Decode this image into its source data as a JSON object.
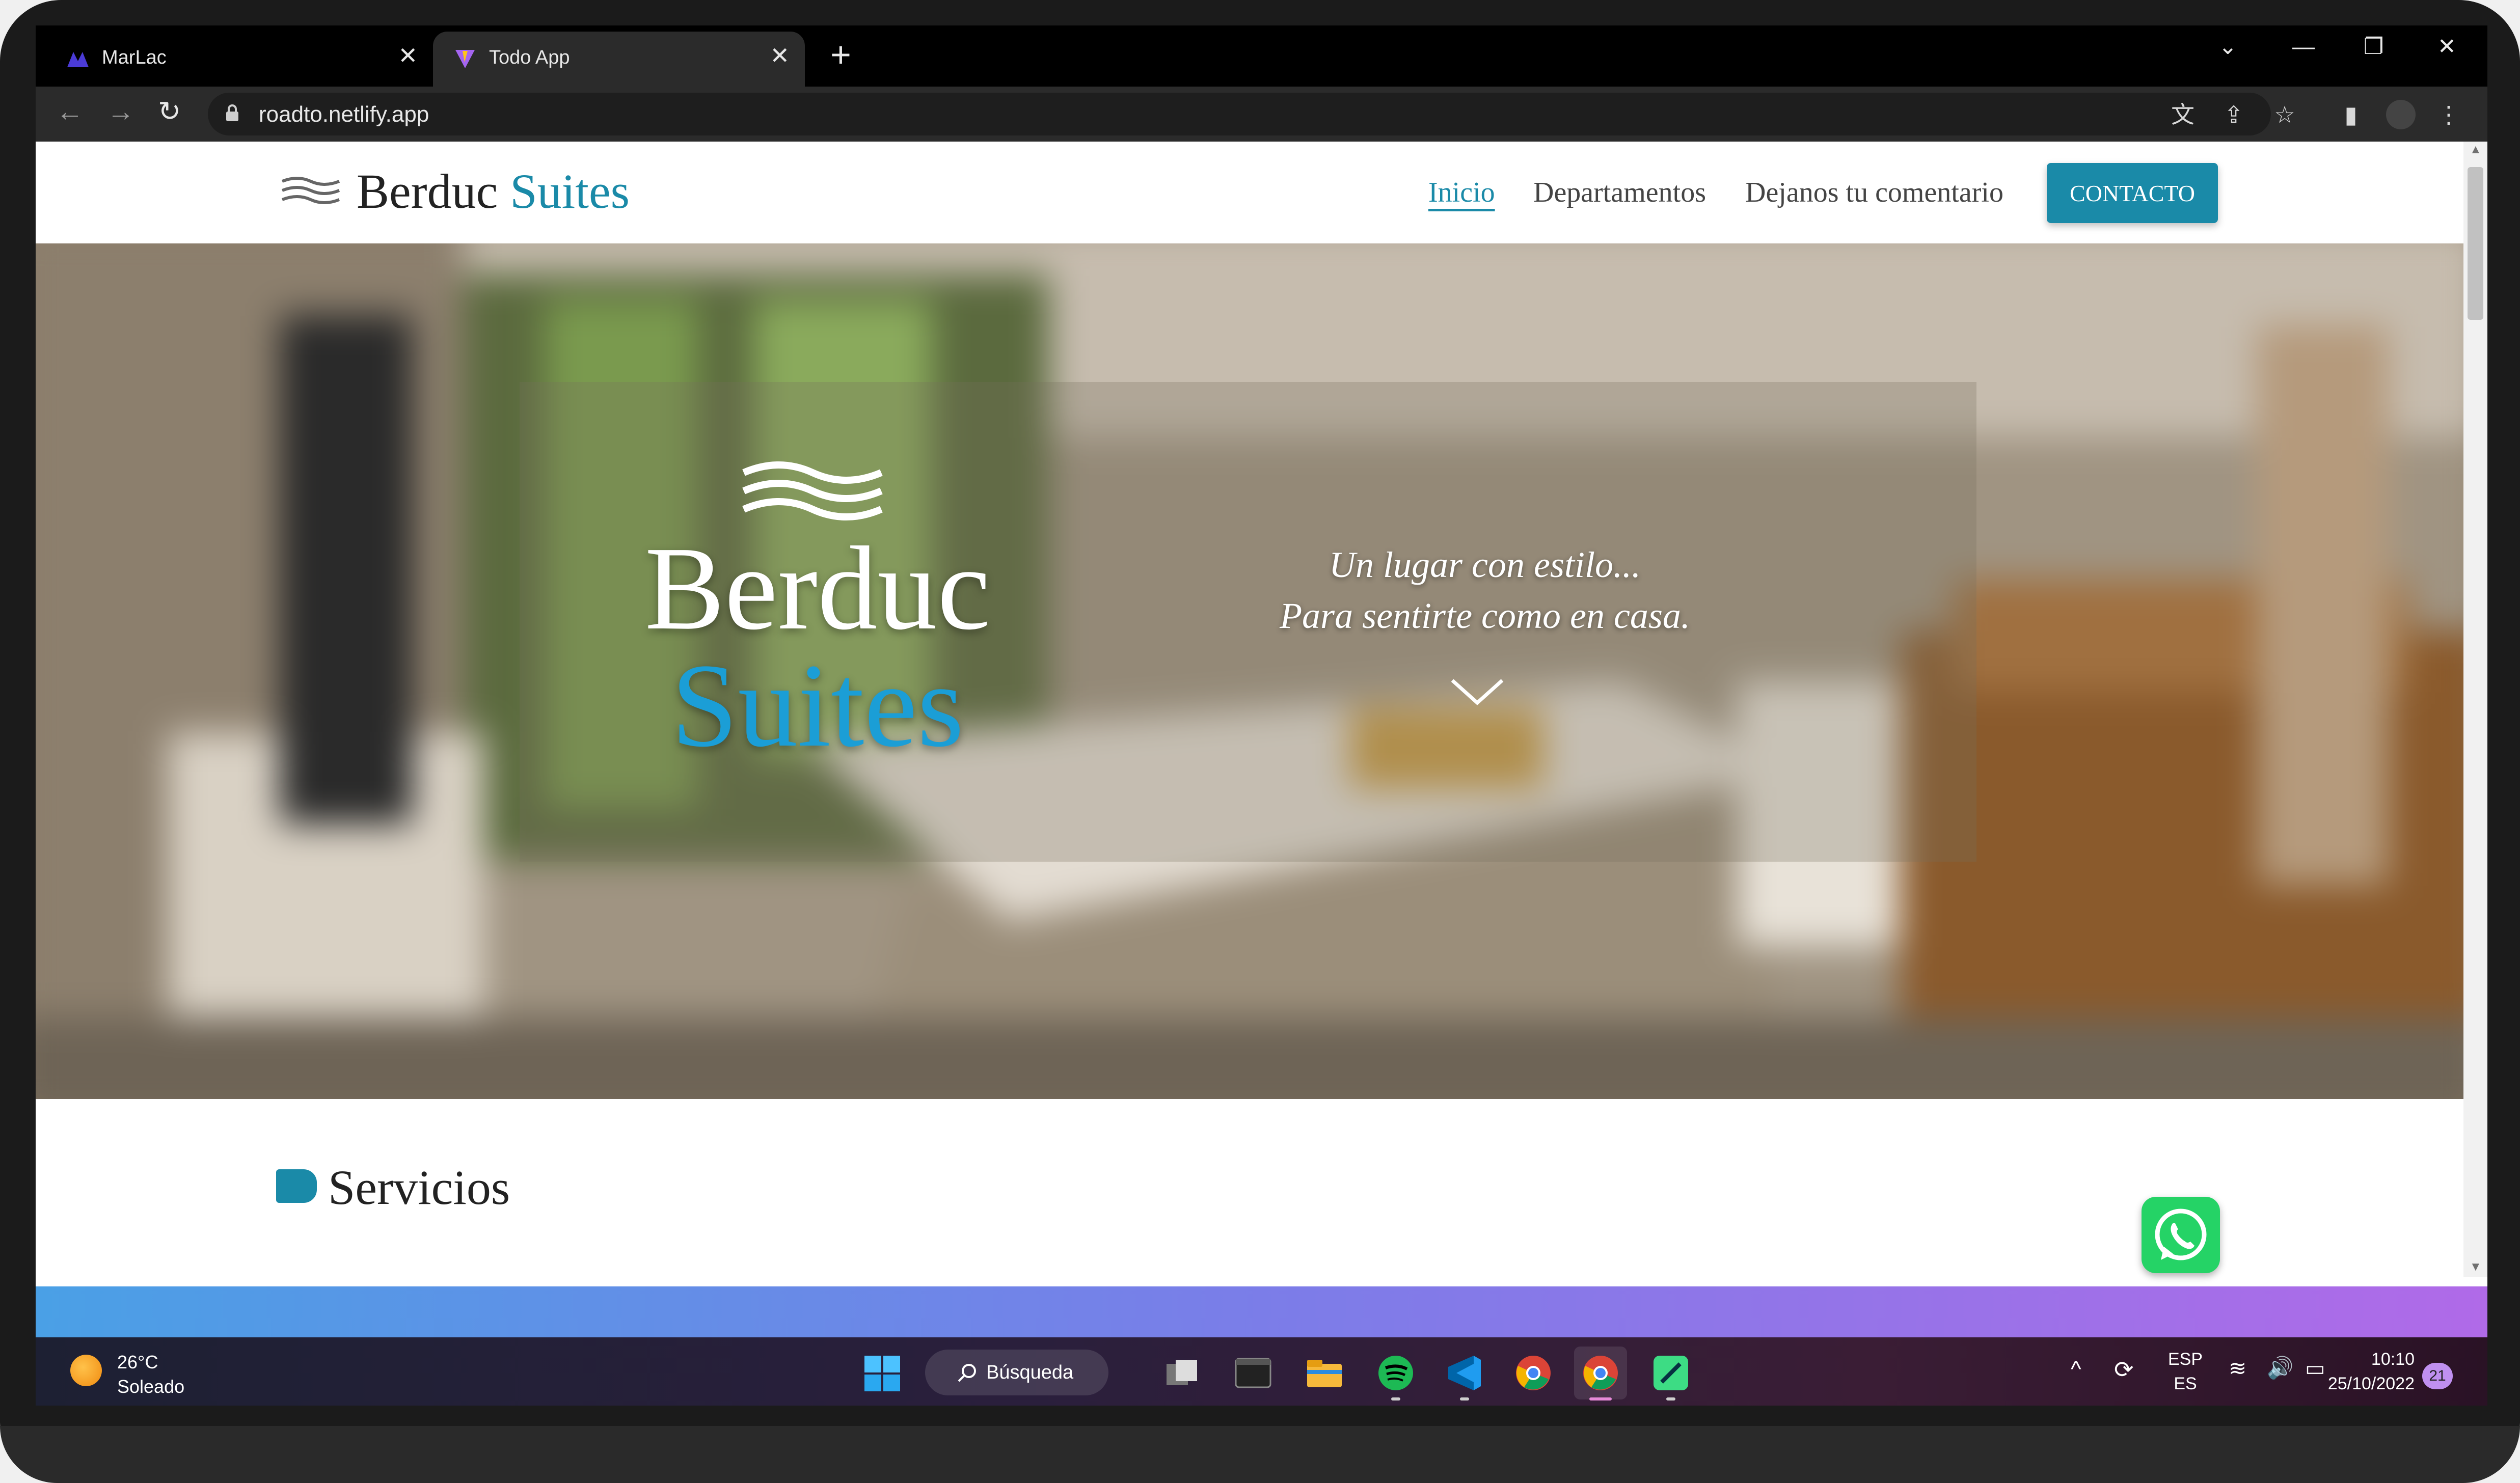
{
  "browser": {
    "tabs": [
      {
        "title": "MarLac",
        "active": false
      },
      {
        "title": "Todo App",
        "active": true
      }
    ],
    "url": "roadto.netlify.app"
  },
  "site": {
    "brand_name": "Berduc",
    "brand_accent": "Suites",
    "nav": [
      {
        "label": "Inicio",
        "active": true
      },
      {
        "label": "Departamentos",
        "active": false
      },
      {
        "label": "Dejanos tu comentario",
        "active": false
      }
    ],
    "contact_label": "CONTACTO",
    "accent_color": "#1a8aa8",
    "hero": {
      "title_line1": "Berduc",
      "title_line2": "Suites",
      "tagline_line1": "Un lugar con estilo...",
      "tagline_line2": "Para sentirte como en casa."
    },
    "services_title": "Servicios"
  },
  "taskbar": {
    "weather_temp": "26°C",
    "weather_desc": "Soleado",
    "search_label": "Búsqueda",
    "lang_line1": "ESP",
    "lang_line2": "ES",
    "time": "10:10",
    "date": "25/10/2022",
    "notification_count": "21"
  }
}
